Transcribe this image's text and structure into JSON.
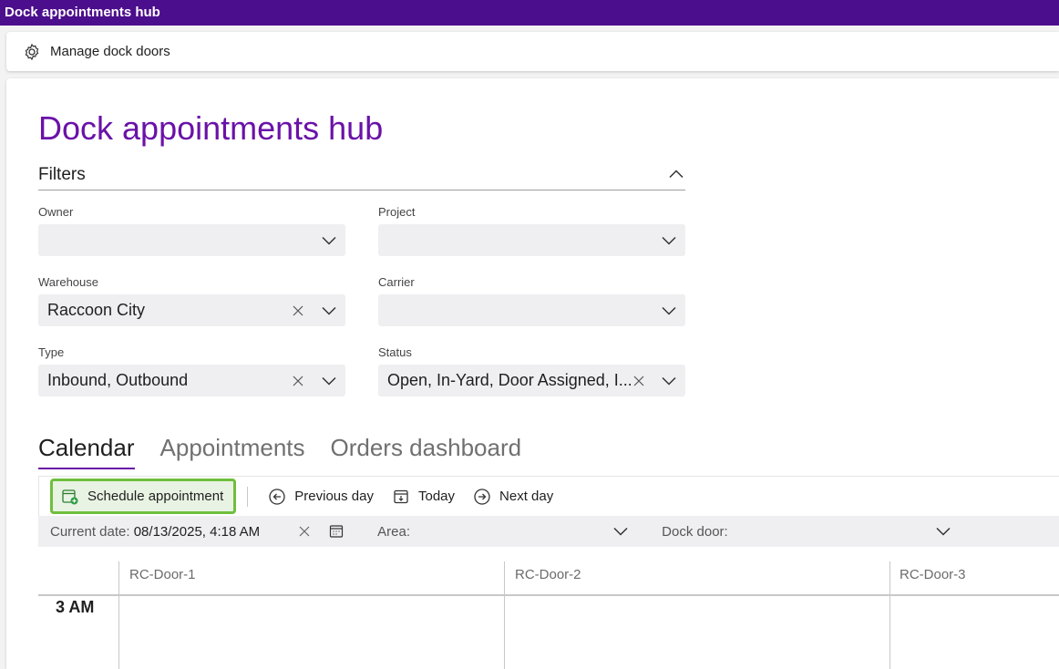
{
  "window": {
    "title": "Dock appointments hub"
  },
  "actionbar": {
    "manage_label": "Manage dock doors",
    "icon": "gear-icon"
  },
  "page": {
    "title": "Dock appointments hub"
  },
  "filters": {
    "title": "Filters",
    "owner": {
      "label": "Owner",
      "value": ""
    },
    "project": {
      "label": "Project",
      "value": ""
    },
    "warehouse": {
      "label": "Warehouse",
      "value": "Raccoon City"
    },
    "carrier": {
      "label": "Carrier",
      "value": ""
    },
    "type": {
      "label": "Type",
      "value": "Inbound, Outbound"
    },
    "status": {
      "label": "Status",
      "value": "Open, In-Yard, Door Assigned, I..."
    }
  },
  "tabs": [
    {
      "label": "Calendar",
      "active": true
    },
    {
      "label": "Appointments",
      "active": false
    },
    {
      "label": "Orders dashboard",
      "active": false
    }
  ],
  "toolbar": {
    "schedule_label": "Schedule appointment",
    "previous_label": "Previous day",
    "today_label": "Today",
    "next_label": "Next day"
  },
  "datebar": {
    "current_date_label": "Current date:",
    "current_date_value": "08/13/2025, 4:18 AM",
    "area_label": "Area:",
    "dock_door_label": "Dock door:"
  },
  "calendar": {
    "doors": [
      "RC-Door-1",
      "RC-Door-2",
      "RC-Door-3"
    ],
    "hours": [
      "3 AM"
    ]
  },
  "colors": {
    "titlebar": "#4b0e8c",
    "accent": "#6a12a8",
    "highlight": "#6fbf3d"
  }
}
